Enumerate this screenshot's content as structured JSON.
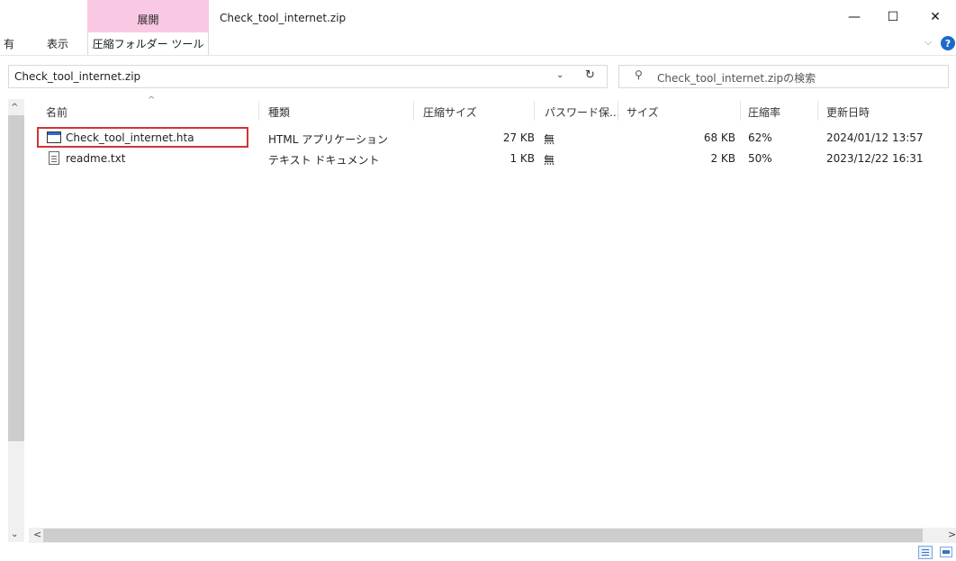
{
  "titlebar": {
    "context_tab": "展開",
    "window_title": "Check_tool_internet.zip",
    "minimize": "—",
    "maximize": "☐",
    "close": "✕"
  },
  "ribbon": {
    "tabs": [
      "有",
      "表示"
    ],
    "active_tool": "圧縮フォルダー ツール",
    "help_chevron": "⌵",
    "help_icon": "?"
  },
  "address": {
    "path": "Check_tool_internet.zip",
    "dropdown": "⌄",
    "refresh": "↻"
  },
  "search": {
    "icon": "⚲",
    "placeholder": "Check_tool_internet.zipの検索"
  },
  "columns": {
    "name": "名前",
    "type": "種類",
    "compressed_size": "圧縮サイズ",
    "password": "パスワード保...",
    "size": "サイズ",
    "ratio": "圧縮率",
    "modified": "更新日時",
    "sort_indicator": "^"
  },
  "files": [
    {
      "name": "Check_tool_internet.hta",
      "type": "HTML アプリケーション",
      "compressed_size": "27 KB",
      "password": "無",
      "size": "68 KB",
      "ratio": "62%",
      "modified": "2024/01/12 13:57",
      "icon": "hta-file-icon"
    },
    {
      "name": "readme.txt",
      "type": "テキスト ドキュメント",
      "compressed_size": "1 KB",
      "password": "無",
      "size": "2 KB",
      "ratio": "50%",
      "modified": "2023/12/22 16:31",
      "icon": "text-file-icon"
    }
  ],
  "scroll": {
    "up": "^",
    "down": "⌄",
    "left": "<",
    "right": ">"
  },
  "colors": {
    "context_tab": "#f9c9e3",
    "selection_outline": "#d13438",
    "help_icon": "#1b6ac9"
  }
}
